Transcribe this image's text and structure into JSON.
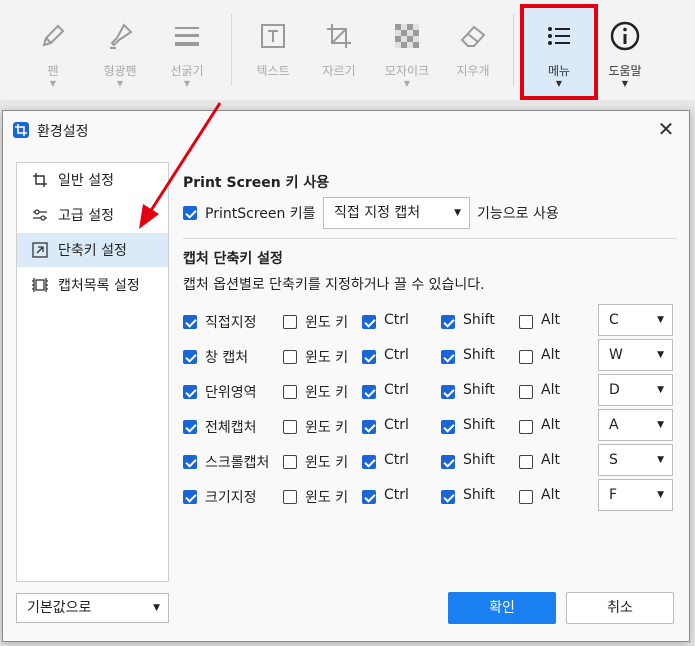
{
  "toolbar": {
    "items": [
      {
        "label": "펜",
        "icon": "pen-icon"
      },
      {
        "label": "형광펜",
        "icon": "highlighter-icon"
      },
      {
        "label": "선굵기",
        "icon": "line-weight-icon"
      },
      {
        "label": "텍스트",
        "icon": "text-icon"
      },
      {
        "label": "자르기",
        "icon": "crop-icon"
      },
      {
        "label": "모자이크",
        "icon": "mosaic-icon"
      },
      {
        "label": "지우개",
        "icon": "eraser-icon"
      },
      {
        "label": "메뉴",
        "icon": "menu-icon"
      },
      {
        "label": "도움말",
        "icon": "help-icon"
      }
    ]
  },
  "dialog": {
    "title": "환경설정",
    "sidebar": [
      {
        "label": "일반 설정",
        "icon": "crop-icon"
      },
      {
        "label": "고급 설정",
        "icon": "sliders-icon"
      },
      {
        "label": "단축키 설정",
        "icon": "shortcut-icon"
      },
      {
        "label": "캡처목록 설정",
        "icon": "capture-list-icon"
      }
    ],
    "defaults_select": "기본값으로",
    "printscreen": {
      "heading": "Print Screen 키 사용",
      "prefix": "PrintScreen 키를",
      "selected": "직접 지정 캡처",
      "suffix": "기능으로 사용",
      "checked": true
    },
    "shortcuts": {
      "heading": "캡처 단축키 설정",
      "description": "캡처 옵션별로 단축키를 지정하거나 끌 수 있습니다.",
      "win_label": "윈도 키",
      "ctrl_label": "Ctrl",
      "shift_label": "Shift",
      "alt_label": "Alt",
      "rows": [
        {
          "name": "직접지정",
          "enabled": true,
          "win": false,
          "ctrl": true,
          "shift": true,
          "alt": false,
          "key": "C"
        },
        {
          "name": "창 캡처",
          "enabled": true,
          "win": false,
          "ctrl": true,
          "shift": true,
          "alt": false,
          "key": "W"
        },
        {
          "name": "단위영역",
          "enabled": true,
          "win": false,
          "ctrl": true,
          "shift": true,
          "alt": false,
          "key": "D"
        },
        {
          "name": "전체캡처",
          "enabled": true,
          "win": false,
          "ctrl": true,
          "shift": true,
          "alt": false,
          "key": "A"
        },
        {
          "name": "스크롤캡처",
          "enabled": true,
          "win": false,
          "ctrl": true,
          "shift": true,
          "alt": false,
          "key": "S"
        },
        {
          "name": "크기지정",
          "enabled": true,
          "win": false,
          "ctrl": true,
          "shift": true,
          "alt": false,
          "key": "F"
        }
      ]
    },
    "ok_label": "확인",
    "cancel_label": "취소"
  },
  "colors": {
    "accent": "#1a7ff0",
    "checkbox": "#1a66d6",
    "highlight_box": "#e3000f",
    "active_bg": "#dbeaf8"
  }
}
